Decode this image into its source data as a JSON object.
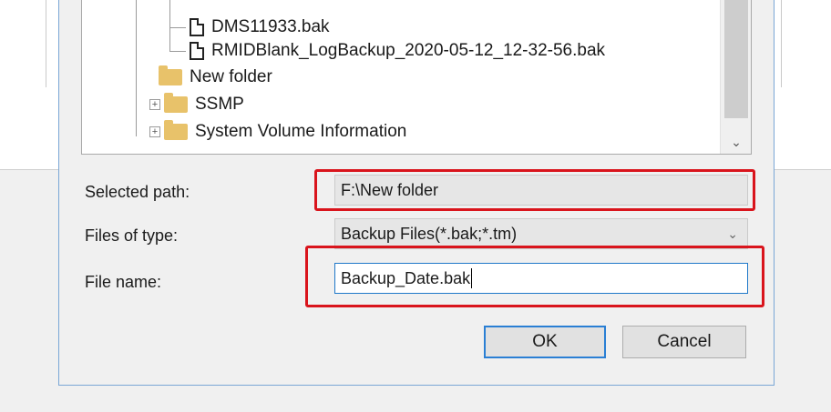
{
  "tree": {
    "items": [
      {
        "label": "DMS11933.bak",
        "icon": "file-icon"
      },
      {
        "label": "RMIDBlank_LogBackup_2020-05-12_12-32-56.bak",
        "icon": "file-icon"
      },
      {
        "label": "New folder",
        "icon": "folder-icon"
      },
      {
        "label": "SSMP",
        "icon": "folder-icon",
        "expander": "+"
      },
      {
        "label": "System Volume Information",
        "icon": "folder-icon",
        "expander": "+"
      }
    ],
    "scroll_down_glyph": "⌄"
  },
  "form": {
    "selected_path_label": "Selected path:",
    "selected_path_value": "F:\\New folder",
    "files_of_type_label": "Files of type:",
    "files_of_type_value": "Backup Files(*.bak;*.tm)",
    "file_name_label": "File name:",
    "file_name_value": "Backup_Date.bak"
  },
  "buttons": {
    "ok": "OK",
    "cancel": "Cancel"
  },
  "colors": {
    "highlight": "#d9141c",
    "focus_border": "#1f78c9",
    "folder": "#e8c26a"
  }
}
